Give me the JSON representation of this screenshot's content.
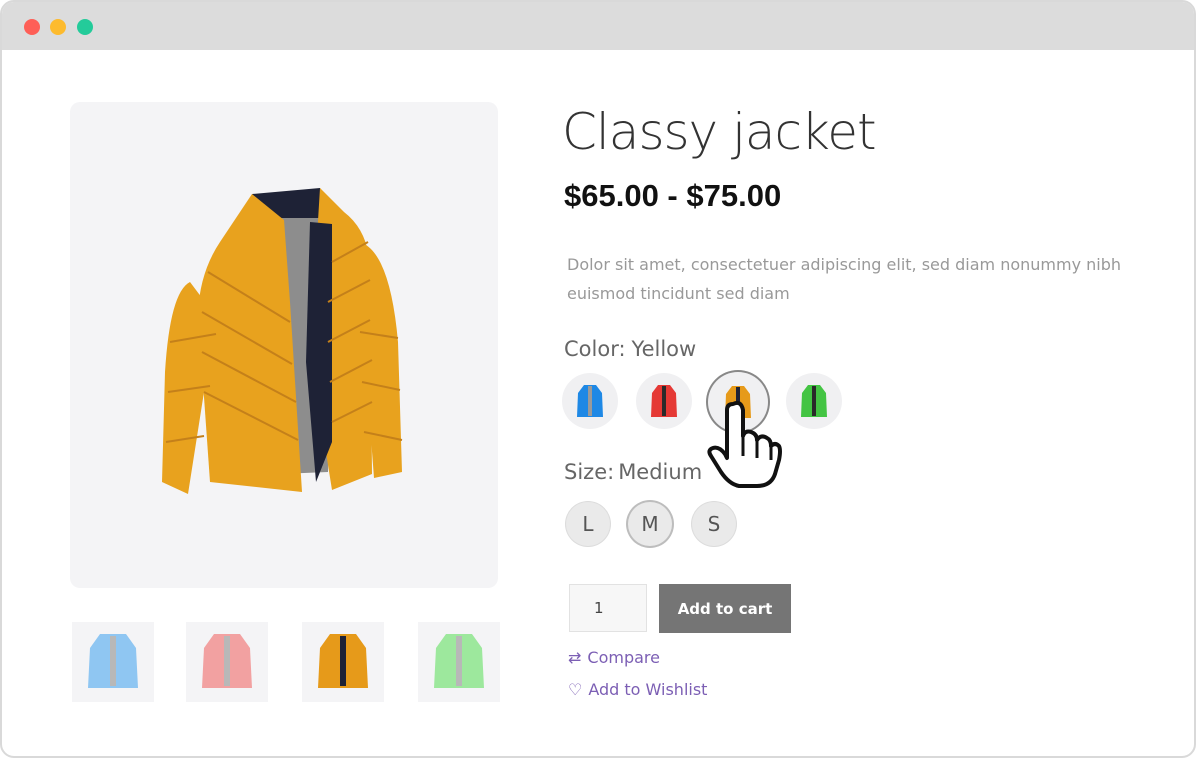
{
  "product": {
    "title": "Classy jacket",
    "price": "$65.00 - $75.00",
    "description": "Dolor sit amet, consectetuer adipiscing elit, sed diam nonummy nibh euismod tincidunt sed diam"
  },
  "color": {
    "label": "Color:",
    "value": "Yellow",
    "swatches": [
      {
        "name": "blue",
        "hex": "#1e88e5"
      },
      {
        "name": "red",
        "hex": "#e53935"
      },
      {
        "name": "yellow",
        "hex": "#e69a1a",
        "selected": true
      },
      {
        "name": "green",
        "hex": "#43c443"
      }
    ]
  },
  "size": {
    "label": "Size:",
    "value": "Medium",
    "options": [
      {
        "label": "L"
      },
      {
        "label": "M",
        "selected": true
      },
      {
        "label": "S"
      }
    ]
  },
  "cart": {
    "quantity": "1",
    "add_label": "Add to cart"
  },
  "links": {
    "compare": "Compare",
    "wishlist": "Add to Wishlist"
  },
  "thumbnails": [
    {
      "color": "#8fc6f2"
    },
    {
      "color": "#f2a1a1"
    },
    {
      "color": "#e69a1a"
    },
    {
      "color": "#9de89d"
    }
  ],
  "colors": {
    "main_jacket": "#e8a21e",
    "collar": "#1e2236",
    "link": "#7c5fb4",
    "button": "#757575"
  }
}
